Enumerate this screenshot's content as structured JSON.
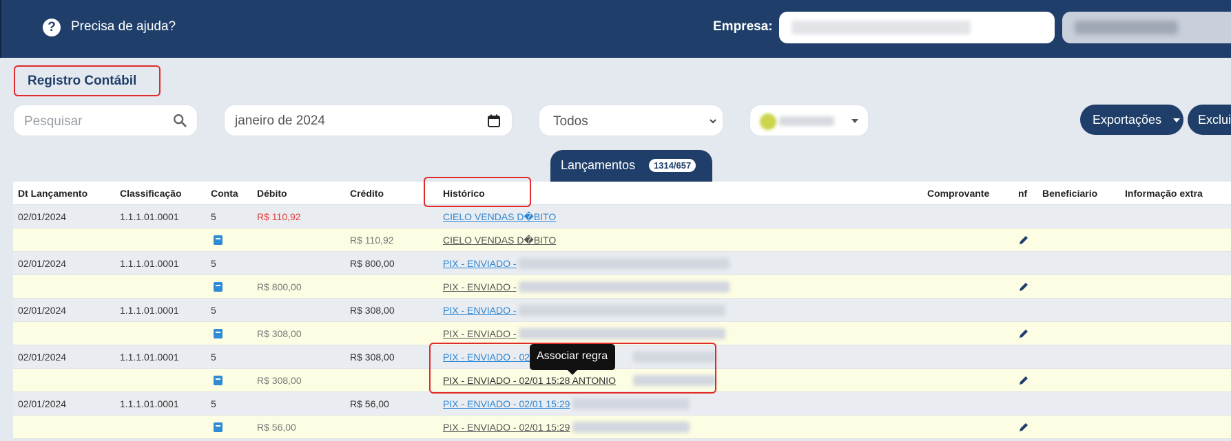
{
  "header": {
    "help_text": "Precisa de ajuda?",
    "empresa_label": "Empresa:"
  },
  "page": {
    "title": "Registro Contábil"
  },
  "filters": {
    "search_placeholder": "Pesquisar",
    "date_value": "janeiro de 2024",
    "select_value": "Todos"
  },
  "buttons": {
    "export_label": "Exportações",
    "exclude_label": "Exclui"
  },
  "tab": {
    "label": "Lançamentos",
    "badge": "1314/657"
  },
  "table": {
    "headers": [
      "Dt Lançamento",
      "Classificação",
      "Conta",
      "Débito",
      "Crédito",
      "Histórico",
      "Comprovante",
      "nf",
      "Beneficiario",
      "Informação extra"
    ],
    "rows": [
      {
        "type": "main",
        "dt": "02/01/2024",
        "class": "1.1.1.01.0001",
        "conta": "5",
        "debito": "R$ 110,92",
        "credito": "",
        "historico": "CIELO VENDAS D�BITO"
      },
      {
        "type": "sub",
        "debito": "",
        "credito": "R$ 110,92",
        "historico": "CIELO VENDAS D�BITO"
      },
      {
        "type": "main",
        "dt": "02/01/2024",
        "class": "1.1.1.01.0001",
        "conta": "5",
        "debito": "",
        "credito": "R$ 800,00",
        "historico": "PIX - ENVIADO -"
      },
      {
        "type": "sub",
        "debito": "R$ 800,00",
        "credito": "",
        "historico": "PIX - ENVIADO -"
      },
      {
        "type": "main",
        "dt": "02/01/2024",
        "class": "1.1.1.01.0001",
        "conta": "5",
        "debito": "",
        "credito": "R$ 308,00",
        "historico": "PIX - ENVIADO -"
      },
      {
        "type": "sub",
        "debito": "R$ 308,00",
        "credito": "",
        "historico": "PIX - ENVIADO -"
      },
      {
        "type": "main",
        "dt": "02/01/2024",
        "class": "1.1.1.01.0001",
        "conta": "5",
        "debito": "",
        "credito": "R$ 308,00",
        "historico": "PIX - ENVIADO - 02"
      },
      {
        "type": "sub",
        "debito": "R$ 308,00",
        "credito": "",
        "historico": "PIX - ENVIADO - 02/01 15:28 ANTONIO"
      },
      {
        "type": "main",
        "dt": "02/01/2024",
        "class": "1.1.1.01.0001",
        "conta": "5",
        "debito": "",
        "credito": "R$ 56,00",
        "historico": "PIX - ENVIADO - 02/01 15:29"
      },
      {
        "type": "sub",
        "debito": "R$ 56,00",
        "credito": "",
        "historico": "PIX - ENVIADO - 02/01 15:29"
      }
    ]
  },
  "tooltip": {
    "text": "Associar regra"
  },
  "icons": {
    "help": "question-circle-icon",
    "search": "search-icon",
    "calendar": "calendar-icon",
    "chevron": "chevron-down-icon",
    "book": "book-icon",
    "pencil": "pencil-icon"
  },
  "colors": {
    "header_bg": "#1f3f6a",
    "accent": "#1f3f6a",
    "link": "#2d86d4",
    "negative": "#e53935",
    "sub_row_bg": "#fdfde4",
    "highlight": "#e12b2b"
  }
}
